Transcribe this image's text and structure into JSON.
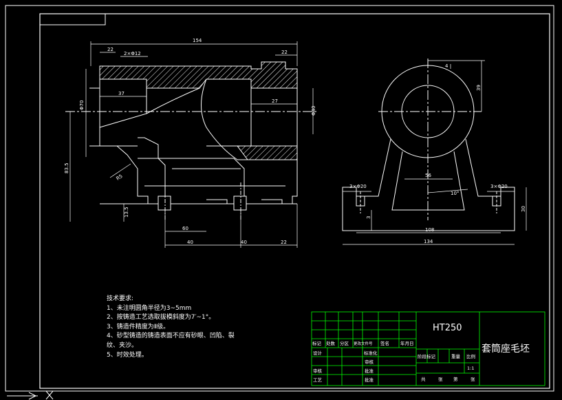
{
  "drawing": {
    "overall_length": "154",
    "dim_top_left": "22",
    "dim_top_mid": "2×Φ12",
    "dim_top_right": "22",
    "dim_37": "37",
    "dim_27": "27",
    "dim_phi70": "Φ70",
    "dim_phi40": "Φ40",
    "dim_835": "83.5",
    "dim_135": "13.5",
    "dim_r": "R5",
    "dim_60": "60",
    "dim_40a": "40",
    "dim_40b": "40",
    "dim_22b": "22",
    "side_39": "39",
    "side_4": "4",
    "side_56": "56",
    "side_angle": "10°",
    "side_3x20_left": "3×Φ20",
    "side_3x20_right": "3×Φ20",
    "side_30": "30",
    "side_3": "3",
    "side_108": "108",
    "side_134": "134"
  },
  "notes": {
    "heading": "技术要求:",
    "items": [
      "1、未注明圆角半径为3~5mm",
      "2、按铸造工艺选取拔模斜度为7′~1°。",
      "3、铸造件精度为Ⅱ级。",
      "4、砂型铸造的铸造表面不应有砂眼、凹陷、裂",
      "纹、夹沙。",
      "5、时效处理。"
    ]
  },
  "title_block": {
    "material": "HT250",
    "part_name": "套筒座毛坯",
    "headers": [
      "标记",
      "处数",
      "分区",
      "更改文件号",
      "签名",
      "年月日"
    ],
    "row_labels": [
      "设计",
      "",
      "审核",
      "工艺"
    ],
    "mid_labels": [
      "标准化",
      "",
      "批准"
    ],
    "mid_labels2": [
      "标准化",
      "审核",
      "批准"
    ],
    "stage_labels": [
      "阶段标记",
      "重量",
      "比例"
    ],
    "scale": "1:1",
    "sheet_labels": [
      "共",
      "张",
      "第",
      "张"
    ]
  },
  "colors": {
    "frame": "#ffffff",
    "outline": "#ffffff",
    "hatch": "#ffffff",
    "title_grid": "#00ff00",
    "title_text": "#ffffff"
  }
}
